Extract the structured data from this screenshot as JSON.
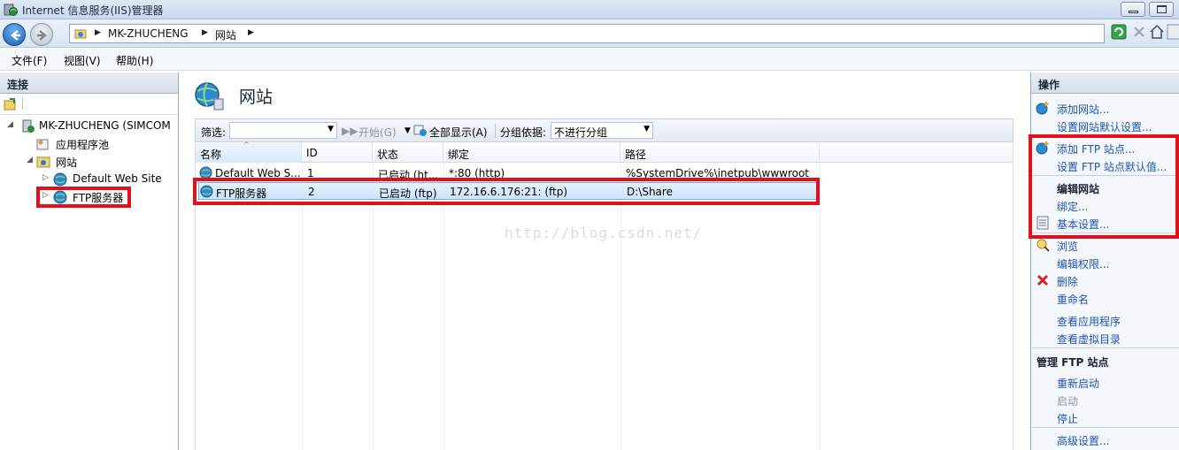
{
  "window": {
    "title": "Internet 信息服务(IIS)管理器"
  },
  "address": {
    "crumbs": [
      "MK-ZHUCHENG",
      "网站"
    ]
  },
  "menu": {
    "items": [
      "文件(F)",
      "视图(V)",
      "帮助(H)"
    ]
  },
  "connections": {
    "header": "连接",
    "tree": {
      "server": "MK-ZHUCHENG (SIMCOM",
      "app_pools": "应用程序池",
      "sites": "网站",
      "site_default": "Default Web Site",
      "site_ftp": "FTP服务器"
    }
  },
  "center": {
    "title": "网站",
    "filter": {
      "label": "筛选:",
      "start": "开始(G)",
      "show_all": "全部显示(A)",
      "group_by_label": "分组依据:",
      "group_by_value": "不进行分组"
    },
    "columns": [
      "名称",
      "ID",
      "状态",
      "绑定",
      "路径"
    ],
    "rows": [
      {
        "name": "Default Web S...",
        "id": "1",
        "status": "已启动 (ht...",
        "binding": "*:80 (http)",
        "path": "%SystemDrive%\\inetpub\\wwwroot"
      },
      {
        "name": "FTP服务器",
        "id": "2",
        "status": "已启动 (ftp)",
        "binding": "172.16.6.176:21: (ftp)",
        "path": "D:\\Share"
      }
    ],
    "watermark": "http://blog.csdn.net/"
  },
  "actions": {
    "header": "操作",
    "add_site": "添加网站...",
    "site_defaults": "设置网站默认设置...",
    "add_ftp": "添加 FTP 站点...",
    "ftp_defaults": "设置 FTP 站点默认值...",
    "edit_site_head": "编辑网站",
    "bindings": "绑定...",
    "basic_settings": "基本设置...",
    "browse": "浏览",
    "edit_perms": "编辑权限...",
    "delete": "删除",
    "rename": "重命名",
    "view_apps": "查看应用程序",
    "view_vdirs": "查看虚拟目录",
    "manage_ftp_head": "管理 FTP 站点",
    "restart": "重新启动",
    "start": "启动",
    "stop": "停止",
    "advanced": "高级设置..."
  },
  "colors": {
    "highlight": "#e3101c",
    "link": "#1f56b0",
    "selection": "#cde3fb"
  }
}
